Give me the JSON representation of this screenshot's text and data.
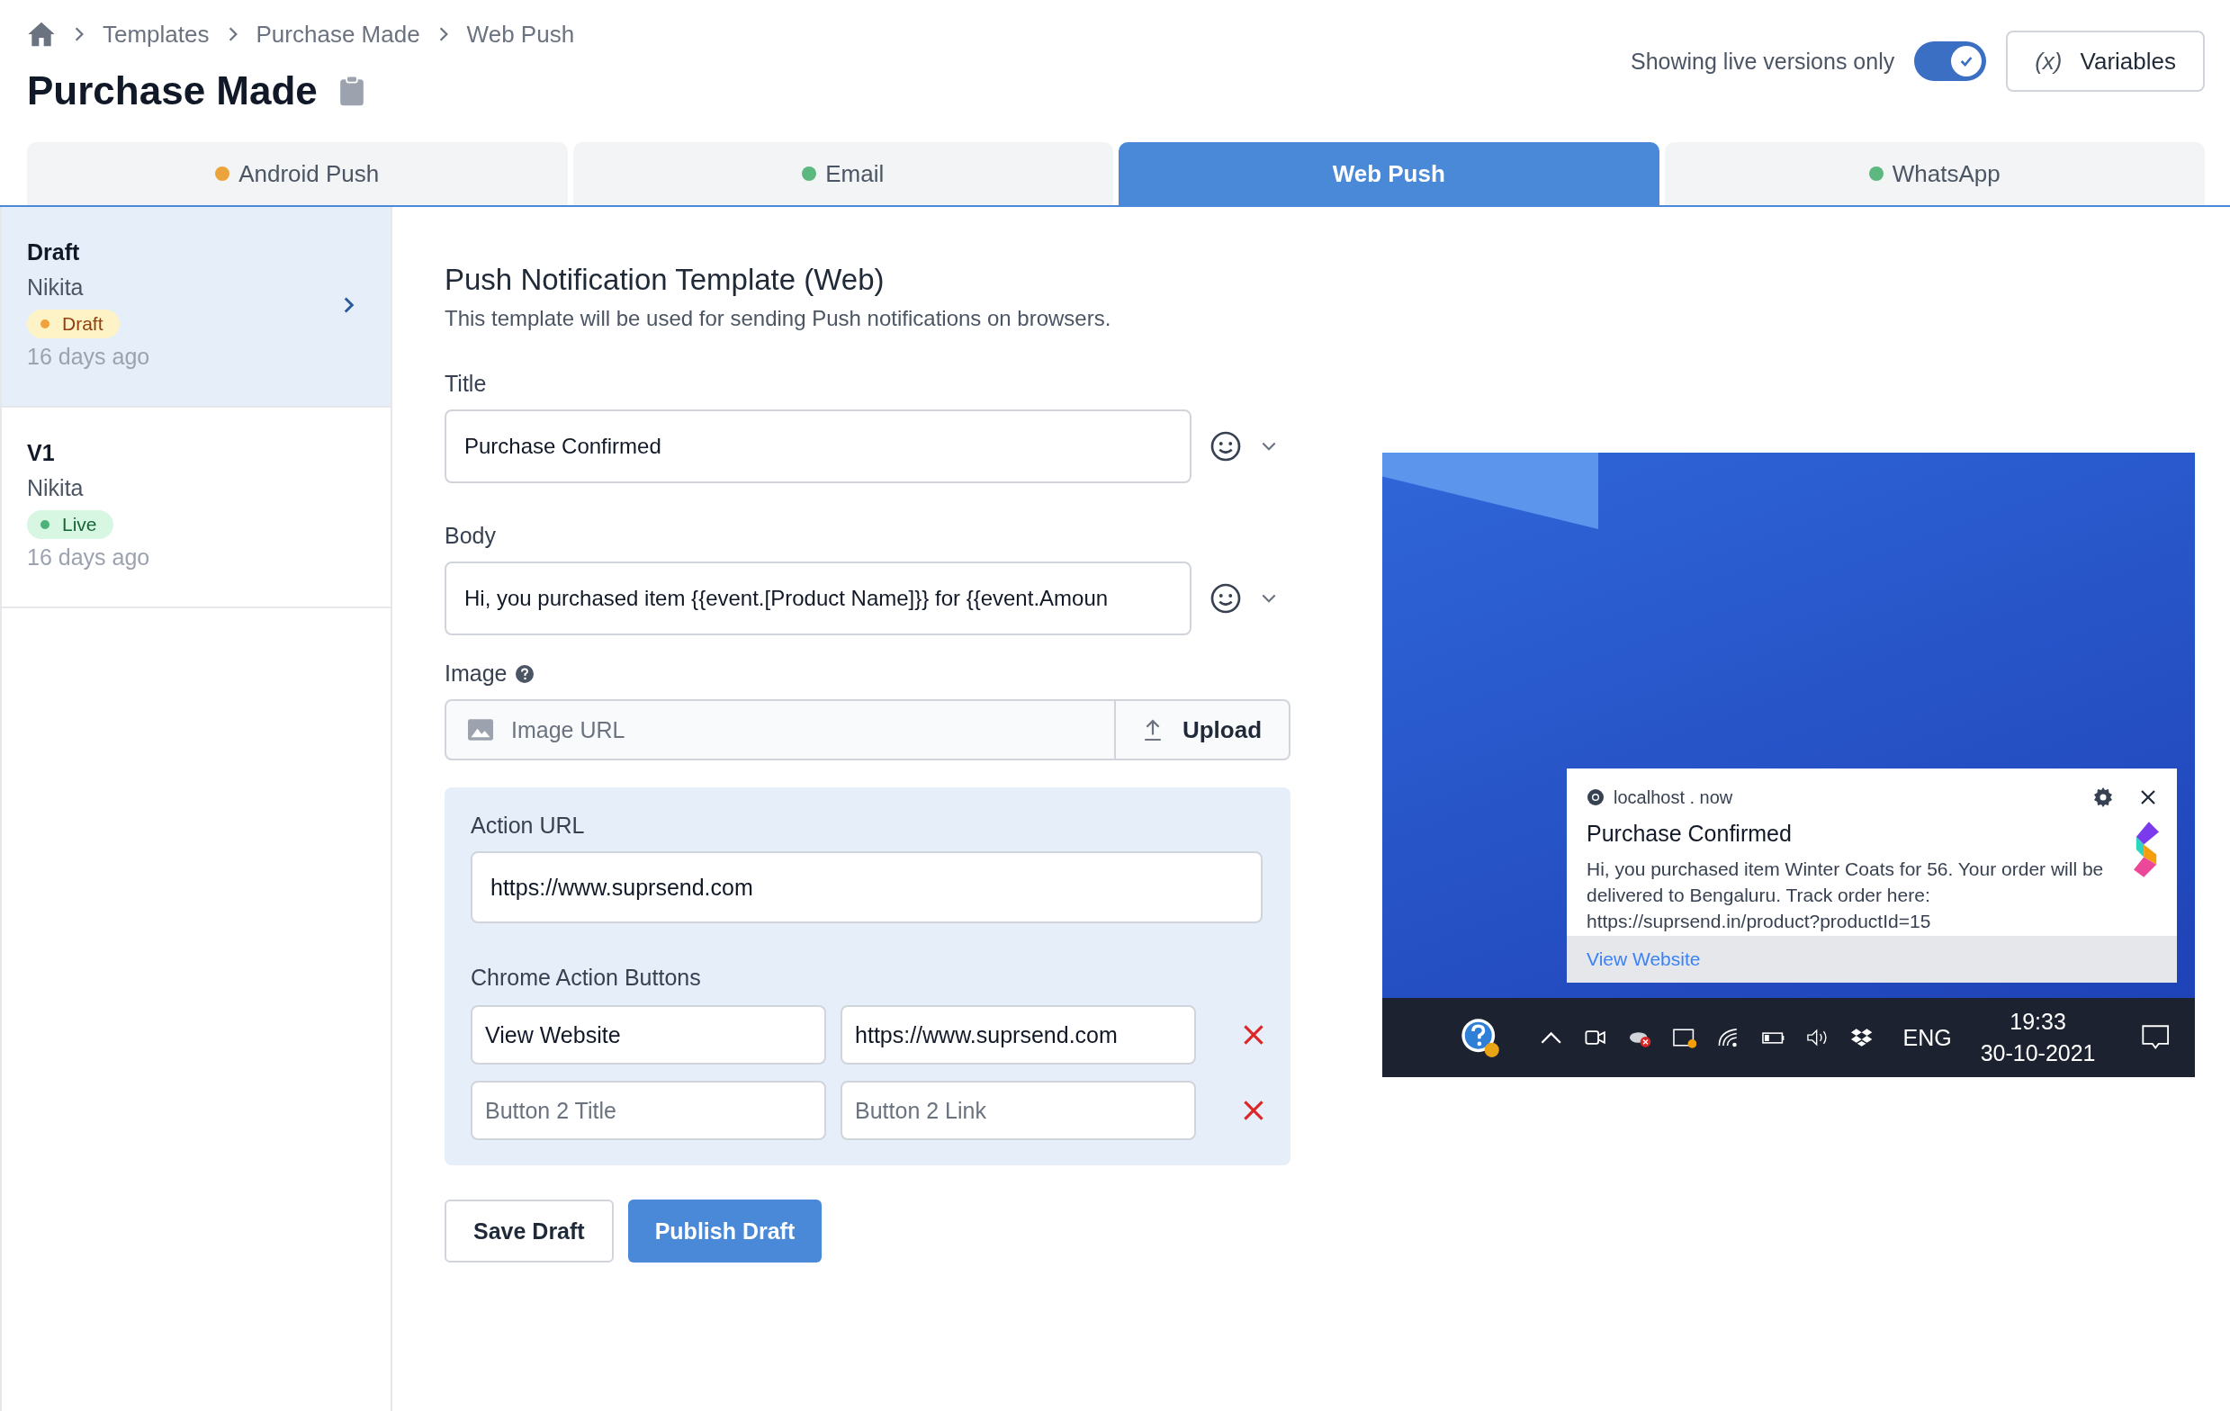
{
  "breadcrumb": [
    "Templates",
    "Purchase Made",
    "Web Push"
  ],
  "page_title": "Purchase Made",
  "toggle": {
    "label": "Showing live versions only",
    "on": true
  },
  "variables_button": {
    "symbol": "(x)",
    "label": "Variables"
  },
  "tabs": [
    {
      "label": "Android Push",
      "selected": false,
      "color": "#eba43b"
    },
    {
      "label": "Email",
      "selected": false,
      "color": "#5cb87f"
    },
    {
      "label": "Web Push",
      "selected": true
    },
    {
      "label": "WhatsApp",
      "selected": false,
      "color": "#5cb87f"
    }
  ],
  "versions": [
    {
      "title": "Draft",
      "author": "Nikita",
      "status": {
        "label": "Draft",
        "kind": "draft"
      },
      "time": "16 days ago",
      "selected": true
    },
    {
      "title": "V1",
      "author": "Nikita",
      "status": {
        "label": "Live",
        "kind": "live"
      },
      "time": "16 days ago",
      "selected": false
    }
  ],
  "form": {
    "heading": "Push Notification Template (Web)",
    "description": "This template will be used for sending Push notifications on browsers.",
    "title": {
      "label": "Title",
      "value": "Purchase Confirmed"
    },
    "body": {
      "label": "Body",
      "value": "Hi, you purchased item {{event.[Product Name]}} for {{event.Amoun"
    },
    "image": {
      "label": "Image",
      "placeholder": "Image URL",
      "button": "Upload"
    },
    "action_url": {
      "label": "Action URL",
      "value": "https://www.suprsend.com"
    },
    "chrome_buttons": {
      "label": "Chrome Action Buttons",
      "rows": [
        {
          "title": {
            "value": "View Website"
          },
          "link": {
            "value": "https://www.suprsend.com"
          }
        },
        {
          "title": {
            "placeholder": "Button 2 Title"
          },
          "link": {
            "placeholder": "Button 2 Link"
          }
        }
      ]
    },
    "buttons": [
      {
        "label": "Save Draft",
        "kind": "secondary"
      },
      {
        "label": "Publish Draft",
        "kind": "primary"
      }
    ]
  },
  "preview": {
    "notification": {
      "source": "localhost . now",
      "title": "Purchase Confirmed",
      "body": "Hi, you purchased item Winter Coats for 56. Your order will be delivered to Bengaluru. Track order here: https://suprsend.in/product?productId=15",
      "action": "View Website"
    },
    "taskbar": {
      "language": "ENG",
      "time": "19:33",
      "date": "30-10-2021"
    }
  }
}
